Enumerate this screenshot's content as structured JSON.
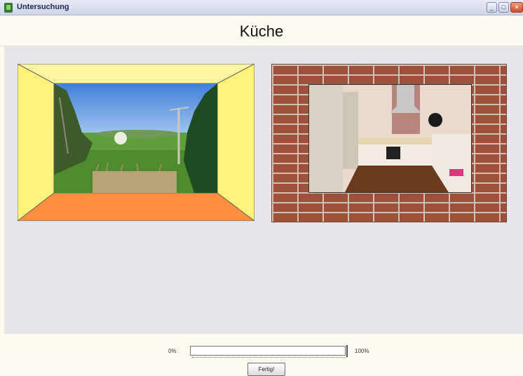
{
  "window": {
    "title": "Untersuchung",
    "minimize_glyph": "_",
    "maximize_glyph": "□",
    "close_glyph": "×"
  },
  "page": {
    "heading": "Küche"
  },
  "images": {
    "left": {
      "name": "room-window-landscape",
      "frame": "yellow-orange room"
    },
    "right": {
      "name": "kitchen-photo",
      "frame": "brick wall"
    }
  },
  "progress": {
    "min_label": "0%",
    "max_label": "100%",
    "value_fraction": 0.0
  },
  "actions": {
    "finish_label": "Fertig!"
  },
  "colors": {
    "title_bar": "#cdd3e6",
    "content_background": "#e6e6ea",
    "wall_yellow": "#fef88a",
    "floor_orange": "#ff8f3f",
    "brick": "#a0503a"
  },
  "icons": [
    "app-icon",
    "minimize-icon",
    "maximize-icon",
    "close-icon"
  ]
}
